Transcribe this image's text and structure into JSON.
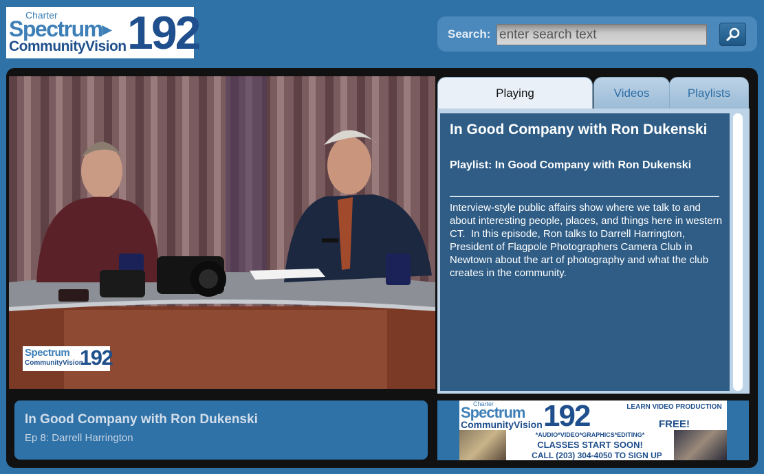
{
  "header": {
    "logo": {
      "charter": "Charter",
      "spectrum": "Spectrum",
      "community_vision": "CommunityVision",
      "channel": "192"
    },
    "search": {
      "label": "Search:",
      "placeholder": "enter search text",
      "value": ""
    }
  },
  "player": {
    "bug": {
      "spectrum": "Spectrum",
      "community_vision": "CommunityVision",
      "channel": "192"
    },
    "caption": {
      "title": "In Good Company with Ron Dukenski",
      "episode": "Ep 8: Darrell Harrington"
    }
  },
  "tabs": [
    {
      "label": "Playing",
      "active": true
    },
    {
      "label": "Videos",
      "active": false
    },
    {
      "label": "Playlists",
      "active": false
    }
  ],
  "playing": {
    "title": "In Good Company with Ron Dukenski",
    "playlist": "Playlist: In Good Company with Ron Dukenski",
    "description": "Interview-style public affairs show where we talk to and about interesting people, places, and things here in western CT.  In this episode, Ron talks to Darrell Harrington, President of Flagpole Photographers Camera Club in Newtown about the art of photography and what the club creates in the community."
  },
  "ad": {
    "charter": "Charter",
    "spectrum": "Spectrum",
    "community_vision": "CommunityVision",
    "channel": "192",
    "learn": "LEARN VIDEO PRODUCTION",
    "free": "FREE!",
    "services": "*AUDIO*VIDEO*GRAPHICS*EDITING*",
    "classes": "CLASSES START SOON!",
    "call": "CALL (203) 304-4050 TO SIGN UP"
  },
  "colors": {
    "background": "#2f72a8",
    "frame": "#111111",
    "panel_dark": "#2f5d86",
    "brand_blue": "#1f4f8c",
    "tab_inactive_text": "#2e6fa6"
  },
  "icons": {
    "search": "magnifier-icon"
  }
}
